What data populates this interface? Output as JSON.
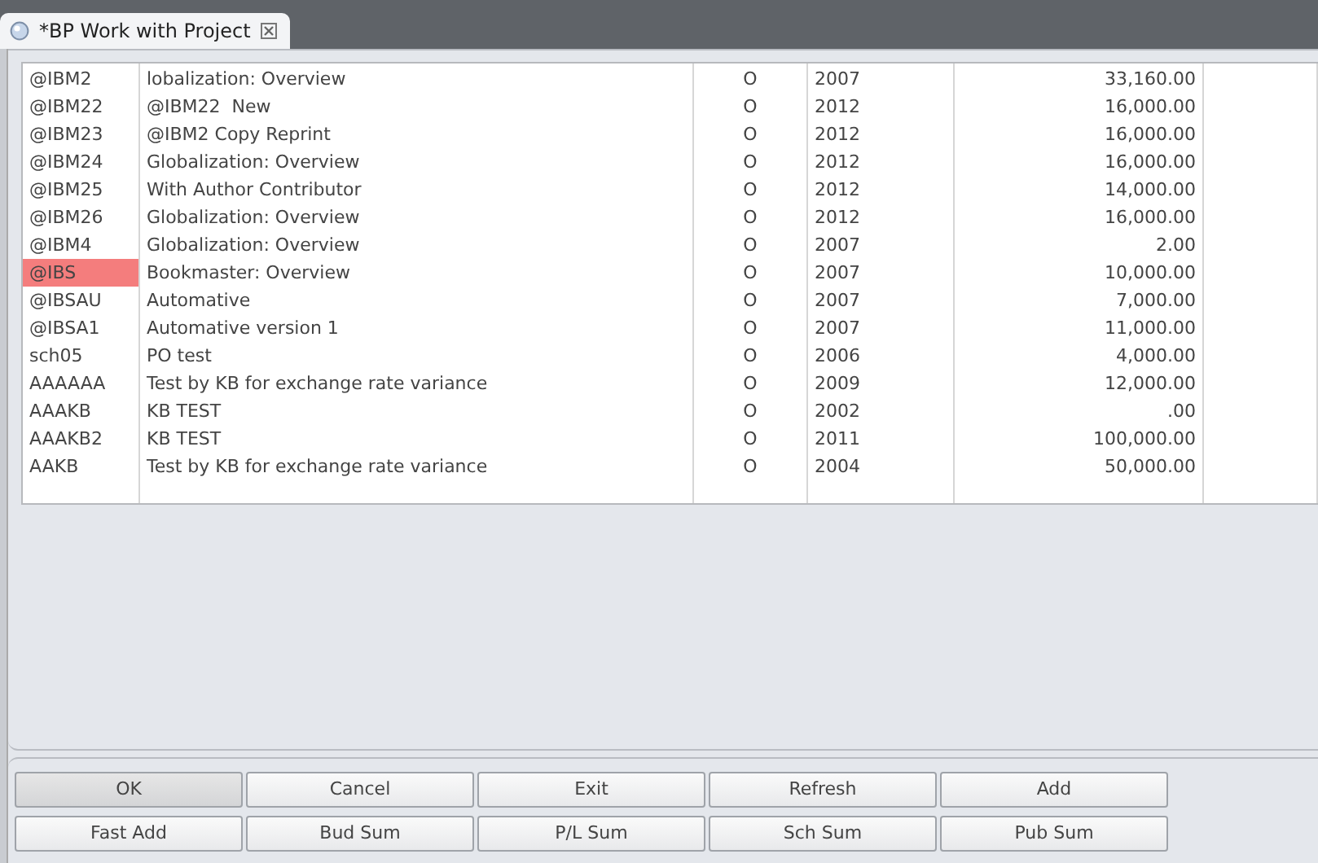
{
  "tab": {
    "title": "*BP Work with Project",
    "selected": true
  },
  "table": {
    "rows": [
      {
        "cells": [
          "@IBM2",
          "lobalization: Overview",
          "O",
          "2007",
          "33,160.00"
        ],
        "selected": false
      },
      {
        "cells": [
          "@IBM22",
          "@IBM22  New",
          "O",
          "2012",
          "16,000.00"
        ],
        "selected": false
      },
      {
        "cells": [
          "@IBM23",
          "@IBM2 Copy Reprint",
          "O",
          "2012",
          "16,000.00"
        ],
        "selected": false
      },
      {
        "cells": [
          "@IBM24",
          "Globalization: Overview",
          "O",
          "2012",
          "16,000.00"
        ],
        "selected": false
      },
      {
        "cells": [
          "@IBM25",
          "With Author Contributor",
          "O",
          "2012",
          "14,000.00"
        ],
        "selected": false
      },
      {
        "cells": [
          "@IBM26",
          "Globalization: Overview",
          "O",
          "2012",
          "16,000.00"
        ],
        "selected": false
      },
      {
        "cells": [
          "@IBM4",
          "Globalization: Overview",
          "O",
          "2007",
          "2.00"
        ],
        "selected": false
      },
      {
        "cells": [
          "@IBS",
          "Bookmaster: Overview",
          "O",
          "2007",
          "10,000.00"
        ],
        "selected": true
      },
      {
        "cells": [
          "@IBSAU",
          "Automative",
          "O",
          "2007",
          "7,000.00"
        ],
        "selected": false
      },
      {
        "cells": [
          "@IBSA1",
          "Automative version 1",
          "O",
          "2007",
          "11,000.00"
        ],
        "selected": false
      },
      {
        "cells": [
          "sch05",
          "PO test",
          "O",
          "2006",
          "4,000.00"
        ],
        "selected": false
      },
      {
        "cells": [
          "AAAAAA",
          "Test by KB for exchange rate variance",
          "O",
          "2009",
          "12,000.00"
        ],
        "selected": false
      },
      {
        "cells": [
          "AAAKB",
          "KB TEST",
          "O",
          "2002",
          ".00"
        ],
        "selected": false
      },
      {
        "cells": [
          "AAAKB2",
          "KB TEST",
          "O",
          "2011",
          "100,000.00"
        ],
        "selected": false
      },
      {
        "cells": [
          "AAKB",
          "Test by KB for exchange rate variance",
          "O",
          "2004",
          "50,000.00"
        ],
        "selected": false
      }
    ]
  },
  "buttons": [
    {
      "label": "OK",
      "focused": true
    },
    {
      "label": "Cancel",
      "focused": false
    },
    {
      "label": "Exit",
      "focused": false
    },
    {
      "label": "Refresh",
      "focused": false
    },
    {
      "label": "Add",
      "focused": false
    },
    {
      "label": "Fast Add",
      "focused": false
    },
    {
      "label": "Bud Sum",
      "focused": false
    },
    {
      "label": "P/L Sum",
      "focused": false
    },
    {
      "label": "Sch Sum",
      "focused": false
    },
    {
      "label": "Pub Sum",
      "focused": false
    }
  ]
}
